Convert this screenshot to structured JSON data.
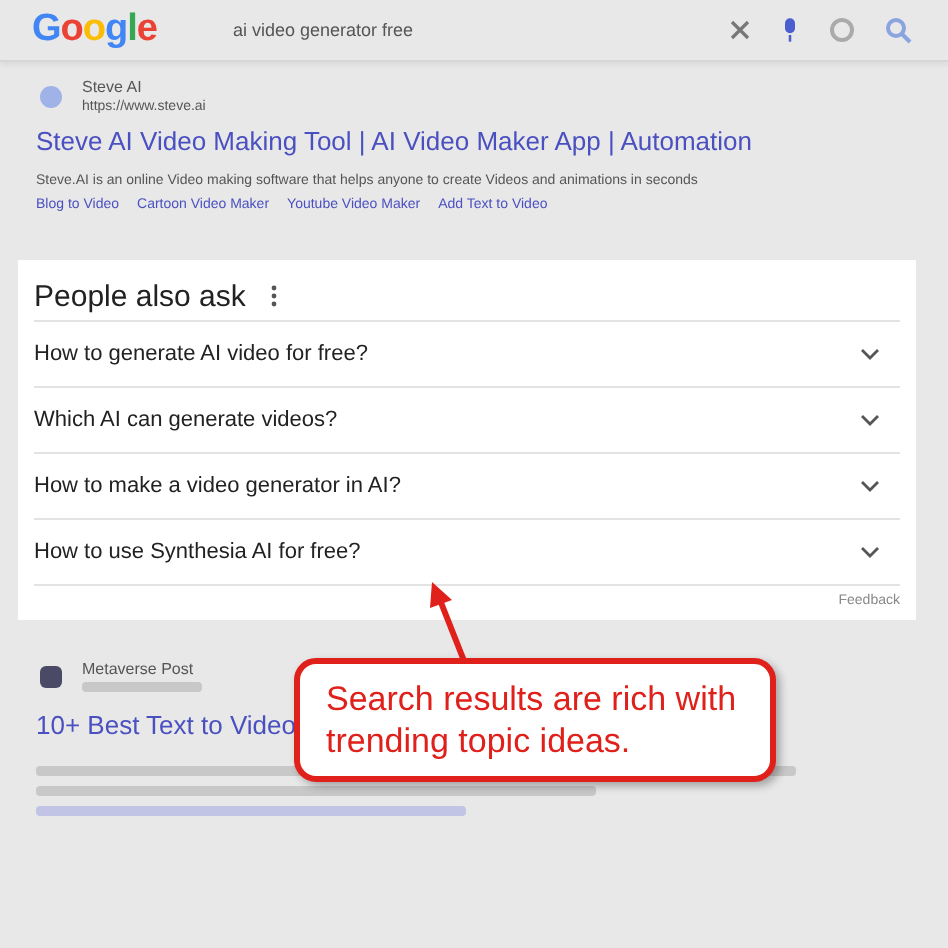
{
  "header": {
    "logo": "Google",
    "query": "ai video generator free"
  },
  "results": [
    {
      "site": "Steve AI",
      "url": "https://www.steve.ai",
      "title": "Steve AI Video Making Tool | AI Video Maker App | Automation",
      "snippet": "Steve.AI is an online Video making software that helps anyone to create Videos and animations in seconds",
      "sitelinks": [
        "Blog to Video",
        "Cartoon Video Maker",
        "Youtube Video Maker",
        "Add Text to Video"
      ]
    }
  ],
  "people_also_ask": {
    "title": "People also ask",
    "questions": [
      {
        "text": "How to generate AI video for free?",
        "expanded": false
      },
      {
        "text": "Which AI can generate videos?",
        "expanded": false
      },
      {
        "text": "How to make a video generator in AI?",
        "expanded": false
      },
      {
        "text": "How to use Synthesia AI for free?",
        "expanded": false
      }
    ],
    "feedback": "Feedback"
  },
  "second_result": {
    "site": "Metaverse Post",
    "title": "10+ Best Text to Video"
  },
  "callout": {
    "text": "Search results are rich with trending topic ideas."
  }
}
